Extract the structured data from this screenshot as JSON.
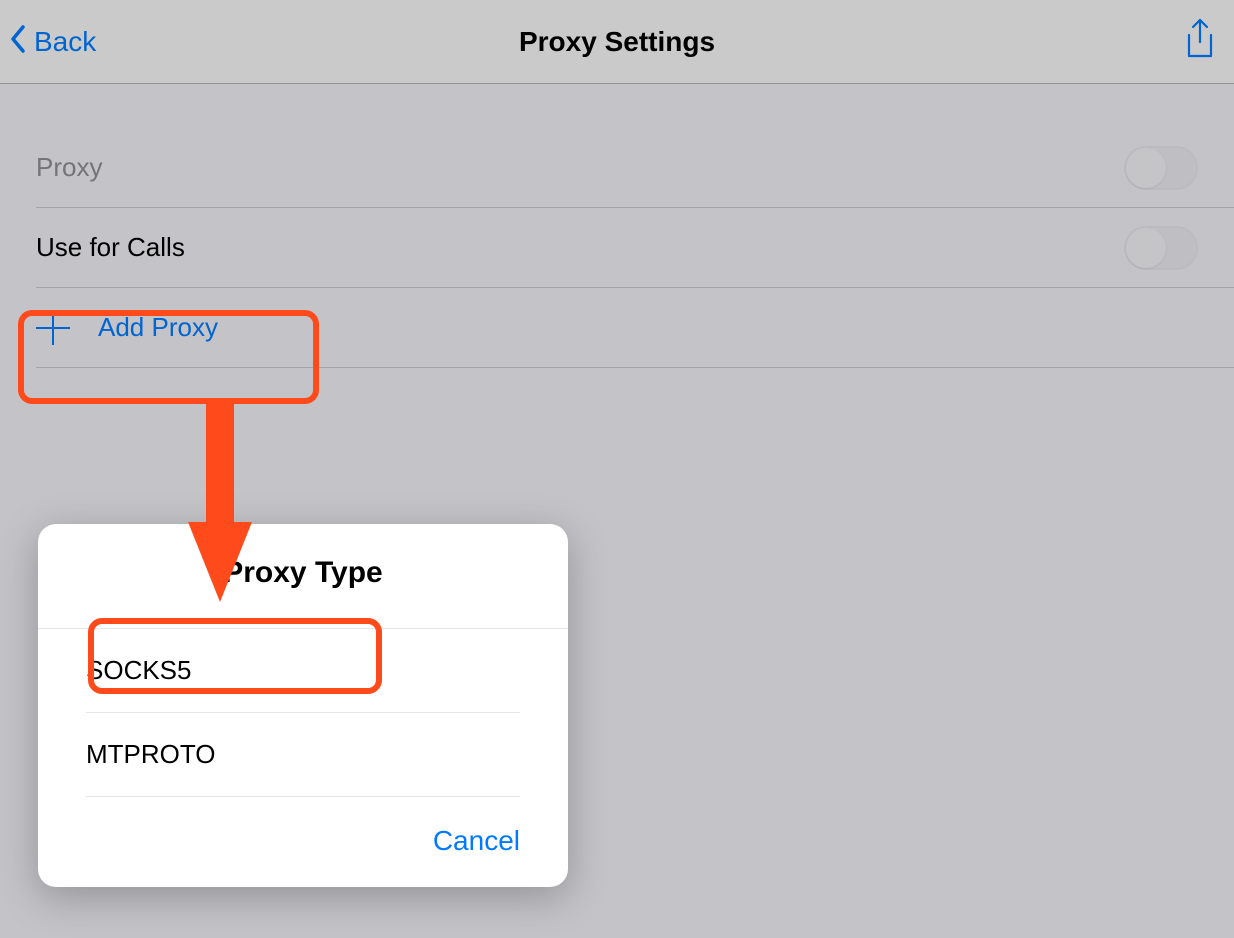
{
  "nav": {
    "back_label": "Back",
    "title": "Proxy Settings"
  },
  "rows": {
    "proxy_label": "Proxy",
    "calls_label": "Use for Calls",
    "add_label": "Add Proxy"
  },
  "popup": {
    "title": "Proxy Type",
    "options": [
      "SOCKS5",
      "MTPROTO"
    ],
    "cancel_label": "Cancel"
  },
  "annotation": {
    "highlight_color": "#ff4a1c"
  }
}
